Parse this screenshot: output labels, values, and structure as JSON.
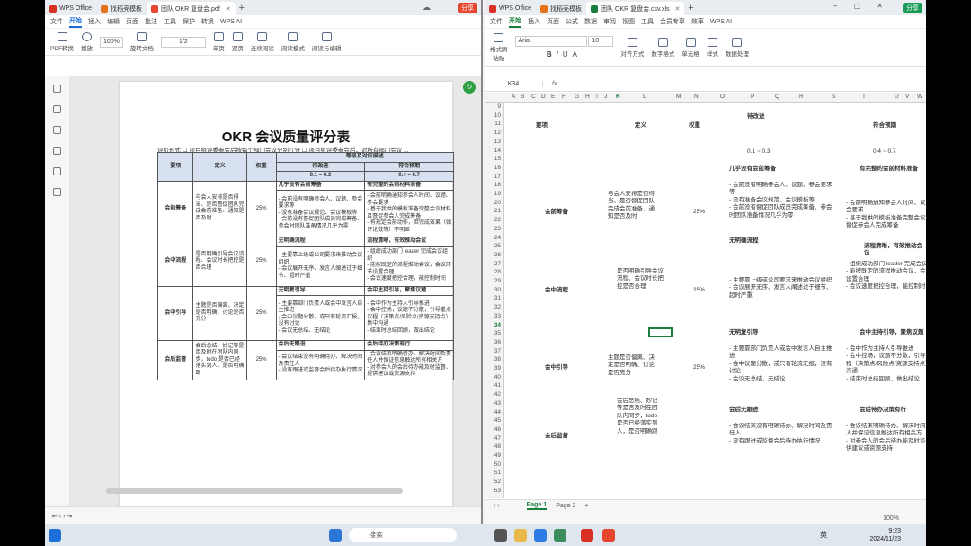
{
  "left_window": {
    "tabs": [
      {
        "label": "WPS Office",
        "color": "#d93025"
      },
      {
        "label": "找稻壳模板",
        "color": "#e8711b"
      },
      {
        "label": "团队 OKR 复盘会.pdf",
        "color": "#e6452e"
      }
    ],
    "share": "分享",
    "menu": [
      "文件",
      "开始",
      "插入",
      "编辑",
      "页面",
      "批注",
      "工具",
      "保护",
      "转换",
      "WPS AI"
    ],
    "active_menu": "开始",
    "ribbon": [
      "PDF转换",
      "播放",
      "旋转文档",
      "单页",
      "双页",
      "连续阅读",
      "阅读模式",
      "阅读与编辑"
    ],
    "zoom": "100%",
    "page_indicator": "1/2",
    "doc": {
      "title": "OKR 会议质量评分表",
      "eval_row": "评价形式    ☐  项目组评委参会后按每个部门会议分别打分 ☐  项目组评委参会后，对所有部门会议 ...",
      "header": {
        "item": "要项",
        "definition": "定义",
        "weight": "权重",
        "level_group": "等级及对应描述",
        "to_improve": "待改进",
        "meets": "符合预期",
        "range1": "0.1 ~ 0.3",
        "range2": "0.4 ~ 0.7"
      },
      "rows": [
        {
          "item": "会前筹备",
          "def": "与会人安排是否得当、是否督促团队完成会前准备、通知是否及时",
          "weight": "25%",
          "low_head": "几乎没有会前筹备",
          "low": "- 会前没有明确参会人、议题、参会要求等\n- 没有准备会议规范、会议模板等\n- 会前没有督促团队成员完成筹备、参会时团队准备情况几乎为零",
          "mid_head": "有完整的会前材料准备",
          "mid": "- 会前明确通知参会人时间、议题、参会要求\n- 基于我供的模板准备完整会议材料且督促参会人完成筹备\n- 有规定会前动作，但完成效果（如评论数等）不明显"
        },
        {
          "item": "会中流程",
          "def": "是否明确引导会议流程、会议时长把控是否合理",
          "weight": "25%",
          "low_head": "无明确流程",
          "low": "- 主要靠上级或公司要求来推动会议组织\n- 会议展开无序、发言人阐述过于细节、超时严重",
          "mid_head": "流程清晰，有效推动会议",
          "mid": "- 组织成功部门 leader 完成会议组织\n- 能按既定的流程推动会议，会议环节设置合理\n- 会议速度把控合理，能控制时间"
        },
        {
          "item": "会中引导",
          "def": "主题是否偏离、决定是否明确、讨论是否充分",
          "weight": "25%",
          "low_head": "无明复引导",
          "low": "- 主要靠部门负责人或会中发言人自主推进\n- 会中议题分散，或只有轮流汇报，没有讨论\n- 会议无总结、无结论",
          "mid_head": "会中主持引导，聚焦议题",
          "mid": "- 会中作为主持人引导推进\n- 会中控场，议题不分散，引导重点议程（决策点/风险点/资源支持点）集中沟通\n- 结束时总结回顾，做出结论"
        },
        {
          "item": "会后监督",
          "def": "会后总结、妙记等是否及时在团队内同步，todo 是否已经落实到人，是否明确跟",
          "weight": "25%",
          "low_head": "会后无跟进",
          "low": "- 会议结束没有明确待办、解决时间及责任人\n- 没有跟进或监督会后待办执行情况",
          "mid_head": "会后待办决策有行",
          "mid": "- 会议结束明确待办、解决时间及责任人并保证信息触达所有相关方\n- 对参会人的会后待办能及时监督、提供建议或资源支持"
        }
      ]
    }
  },
  "right_window": {
    "tabs": [
      {
        "label": "WPS Office",
        "color": "#d93025"
      },
      {
        "label": "找稻壳模板",
        "color": "#e8711b"
      },
      {
        "label": "团队 OKR 复盘会.csv.xls",
        "color": "#1a7f3c"
      }
    ],
    "share": "分享",
    "menu": [
      "文件",
      "开始",
      "插入",
      "页面",
      "公式",
      "数据",
      "审阅",
      "视图",
      "工具",
      "会员专享",
      "效率",
      "WPS AI"
    ],
    "active_menu": "开始",
    "font": "Arial",
    "font_size": "10",
    "ribbon": [
      "格式刷",
      "粘贴",
      "对齐方式",
      "数字格式",
      "单元格",
      "样式",
      "数据处理"
    ],
    "name_box": "K34",
    "fx": "fx",
    "columns": [
      "A",
      "B",
      "C",
      "D",
      "E",
      "F",
      "G",
      "H",
      "I",
      "J",
      "K",
      "L",
      "M",
      "N",
      "O",
      "P",
      "Q",
      "R",
      "S",
      "T",
      "U",
      "V",
      "W"
    ],
    "rows": [
      "9",
      "10",
      "11",
      "12",
      "13",
      "14",
      "15",
      "16",
      "17",
      "18",
      "19",
      "20",
      "21",
      "22",
      "23",
      "24",
      "25",
      "26",
      "27",
      "28",
      "29",
      "30",
      "31",
      "32",
      "33",
      "34",
      "35",
      "36",
      "37",
      "38",
      "39",
      "40",
      "41",
      "42",
      "43",
      "44",
      "45",
      "46",
      "47",
      "48",
      "49",
      "50",
      "51",
      "52",
      "53"
    ],
    "cells": {
      "c_header_improve": "待改进",
      "c_header_meets": "符合预期",
      "c_item": "要项",
      "c_def": "定义",
      "c_weight": "权重",
      "c_r1": "0.1 ~ 0.3",
      "c_r2": "0.4 ~ 0.7",
      "c_low1h": "几乎没有会前筹备",
      "c_mid1h": "有完整的会前材料准备",
      "c_item1": "会前筹备",
      "c_def1": "与会人安排是否得当、是否督促团队完成会前准备、通知是否及时",
      "c_w1": "25%",
      "c_low1": "- 会前没有明确参会人、议题、参会要求等\n- 没有准备会议规范、会议模板等\n- 会前没有督促团队成员完成筹备、参会时团队准备情况几乎为零",
      "c_mid1": "- 会前明确通知参会人时间、议题、参会要求\n- 基于我供的模板准备完整会议材料且督促参会人完成筹备",
      "c_low2h": "无明确流程",
      "c_mid2h": "流程清晰，有效推动会议",
      "c_item2": "会中流程",
      "c_def2": "是否明确引导会议流程、会议时长把控是否合理",
      "c_w2": "25%",
      "c_low2": "- 主要靠上级或公司要求来推动会议组织\n- 会议展开无序、发言人阐述过于细节、超时严重",
      "c_mid2": "- 组织成功部门 leader 完成会议组织\n- 能按既定的流程推动会议，会议环节设置合理\n- 会议速度把控合理，能控制时间",
      "c_low3h": "无明复引导",
      "c_mid3h": "会中主持引导，聚焦议题",
      "c_item3": "会中引导",
      "c_def3": "主题是否偏离、决定是否明确、讨论是否充分",
      "c_w3": "25%",
      "c_low3": "- 主要靠部门负责人或会中发言人自主推进\n- 会中议题分散，或只有轮流汇报，没有讨论\n- 会议无总结、无结论",
      "c_mid3": "- 会中作为主持人引导推进\n- 会中控场，议题不分散，引导重点议程（决策点/风险点/资源支持点）集中沟通\n- 结束时总结回顾，做出结论",
      "c_low4h": "会后无跟进",
      "c_mid4h": "会后待办决策有行",
      "c_item4": "会后监督",
      "c_def4": "会后总结、妙记等是否及时在团队内同步，todo 是否已经落实到人，是否明确跟",
      "c_low4": "- 会议结束没有明确待办、解决时间及责任人\n- 没有跟进或监督会后待办执行情况",
      "c_mid4": "- 会议结束明确待办、解决时间及责任人并保证信息触达所有相关方\n- 对参会人的会后待办能及时监督、提供建议或资源支持"
    },
    "sheets": [
      "Page 1",
      "Page 2"
    ],
    "active_sheet": "Page 1",
    "zoom": "100%"
  },
  "taskbar": {
    "search_placeholder": "搜索",
    "time": "9:23",
    "date": "2024/11/23",
    "lang": "英"
  }
}
